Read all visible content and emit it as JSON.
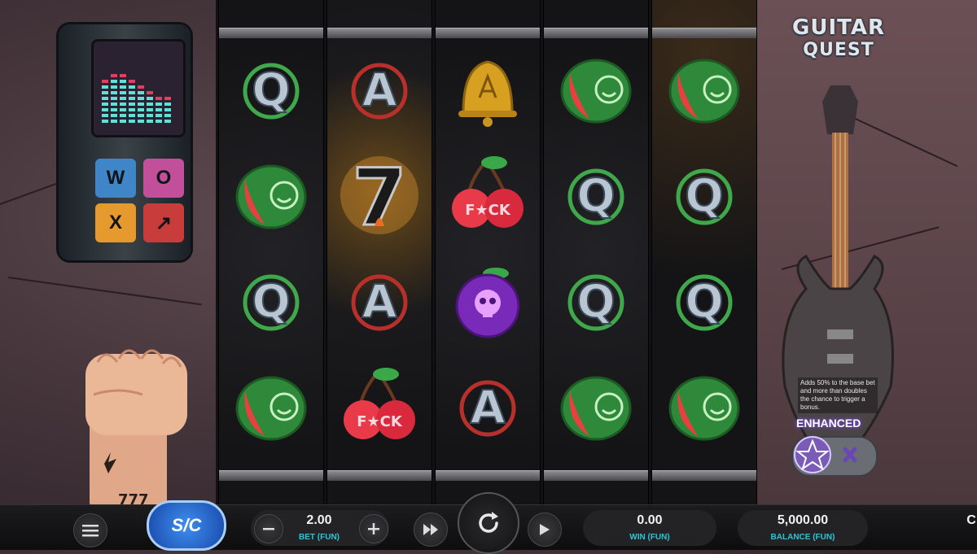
{
  "game": {
    "logo_line1": "GUITAR",
    "logo_line2": "QUEST"
  },
  "device": {
    "pads": [
      {
        "label": "W",
        "color": "#3e86c8"
      },
      {
        "label": "O",
        "color": "#c24f9a"
      },
      {
        "label": "X",
        "color": "#e69a2e"
      },
      {
        "label": "↗",
        "color": "#c83c3c"
      }
    ]
  },
  "fist_tattoo": "777",
  "reels": [
    [
      "Q",
      "watermelon",
      "Q",
      "watermelon"
    ],
    [
      "A",
      "seven",
      "A",
      "cherry"
    ],
    [
      "bell",
      "cherry",
      "plum",
      "A"
    ],
    [
      "watermelon",
      "Q",
      "Q",
      "watermelon"
    ],
    [
      "watermelon",
      "Q",
      "Q",
      "watermelon"
    ]
  ],
  "cherry_text": "F★CK",
  "enhanced": {
    "tooltip": "Adds 50% to the base bet and more than doubles the chance to trigger a bonus.",
    "label": "ENHANCED"
  },
  "controls": {
    "menu_icon": "hamburger-icon",
    "sc_label": "S/C",
    "bet_value": "2.00",
    "bet_label": "BET (FUN)",
    "win_value": "0.00",
    "win_label": "WIN (FUN)",
    "balance_value": "5,000.00",
    "balance_label": "BALANCE (FUN)",
    "edge_text": "C"
  },
  "colors": {
    "accent_cyan": "#2ec4d6",
    "sc_blue": "#1f6fd8"
  }
}
